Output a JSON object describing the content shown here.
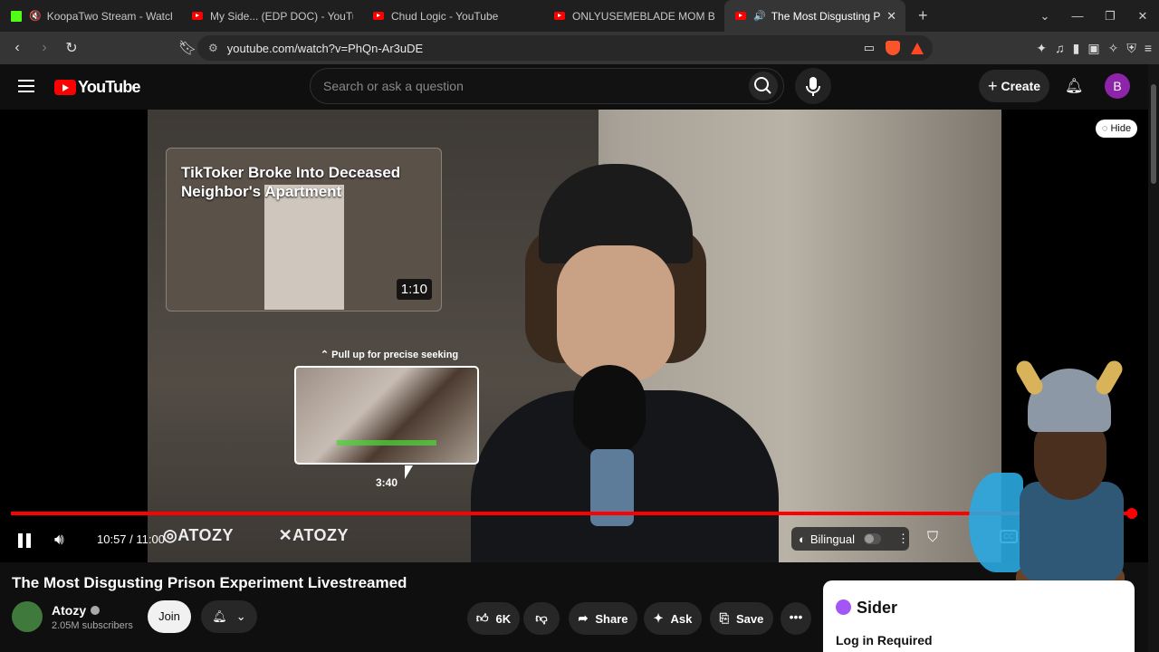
{
  "browser": {
    "tabs": [
      {
        "title": "KoopaTwo Stream - Watch Live o",
        "icon": "kick"
      },
      {
        "title": "My Side... (EDP DOC) - YouTube",
        "icon": "youtube"
      },
      {
        "title": "Chud Logic - YouTube",
        "icon": "youtube"
      },
      {
        "title": "ONLYUSEMEBLADE MOM BREAKS D",
        "icon": "youtube"
      },
      {
        "title": "The Most Disgusting Prison E",
        "icon": "youtube",
        "active": true
      }
    ],
    "url": "youtube.com/watch?v=PhQn-Ar3uDE"
  },
  "youtube": {
    "logo_text": "YouTube",
    "search_placeholder": "Search or ask a question",
    "create_label": "Create",
    "avatar_letter": "B",
    "accent": "#ff0000"
  },
  "player": {
    "hide_label": "Hide",
    "endcard": {
      "title": "TikToker Broke Into Deceased Neighbor's Apartment",
      "duration": "1:10"
    },
    "seek_hint": "Pull up for precise seeking",
    "preview_time": "3:40",
    "time_display": "10:57 / 11:00",
    "progress_fraction": 0.995,
    "watermarks": [
      "ATOZY",
      "ATOZY"
    ],
    "bilingual_label": "Bilingual"
  },
  "video": {
    "title": "The Most Disgusting Prison Experiment Livestreamed",
    "channel": "Atozy",
    "subscribers": "2.05M subscribers",
    "join_label": "Join",
    "likes": "6K",
    "share_label": "Share",
    "ask_label": "Ask",
    "save_label": "Save"
  },
  "sider": {
    "brand": "Sider",
    "login_text": "Log in Required"
  }
}
